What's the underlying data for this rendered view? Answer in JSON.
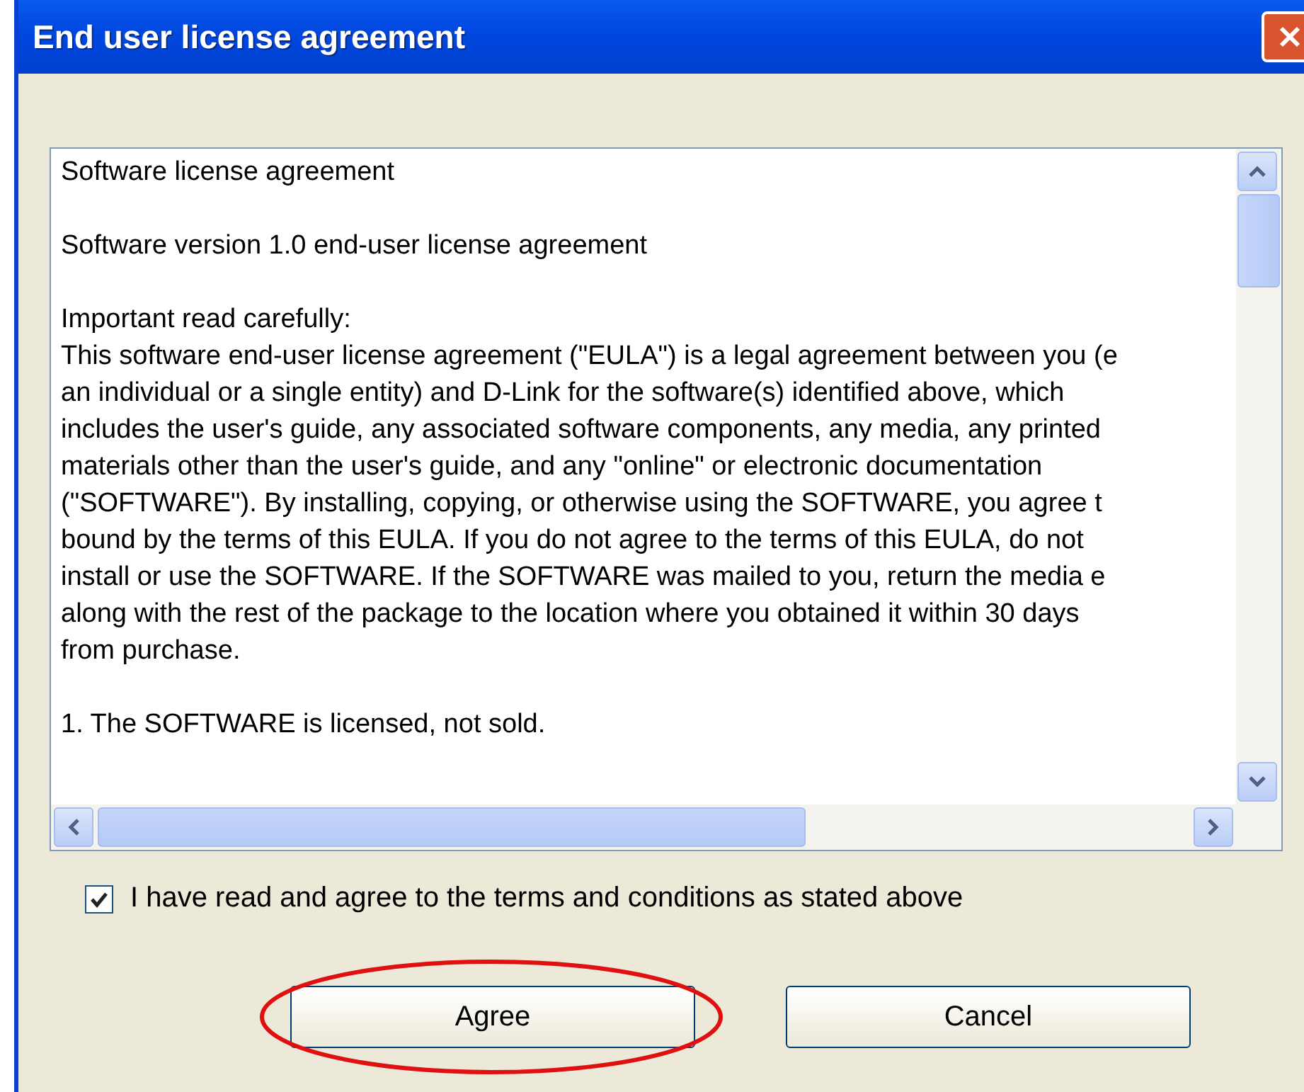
{
  "window": {
    "title": "End user license agreement"
  },
  "agreement": {
    "paragraphs": [
      [
        "Software license agreement"
      ],
      [
        "Software version 1.0 end-user license agreement"
      ],
      [
        "Important read carefully:",
        "This software end-user license agreement (\"EULA\") is a legal agreement between you (e",
        "an individual or a single entity) and D-Link for the software(s) identified above, which",
        "includes the user's guide, any associated software components, any media, any printed",
        "materials other than the user's guide, and any \"online\" or electronic documentation",
        "(\"SOFTWARE\"). By installing, copying, or otherwise using the SOFTWARE, you agree t",
        "bound by the terms of this EULA. If you do not agree to the terms of this EULA, do not",
        "install or use the SOFTWARE. If the SOFTWARE was mailed to you, return the media e",
        "along with the rest of the package to the location where you obtained it within 30 days",
        "from purchase."
      ],
      [
        "1. The SOFTWARE is licensed, not sold."
      ]
    ]
  },
  "agree_checkbox": {
    "label": "I have read and agree to the terms and conditions as stated above",
    "checked": true
  },
  "buttons": [
    {
      "label": "Agree",
      "kind": "primary"
    },
    {
      "label": "Cancel",
      "kind": "normal"
    }
  ]
}
